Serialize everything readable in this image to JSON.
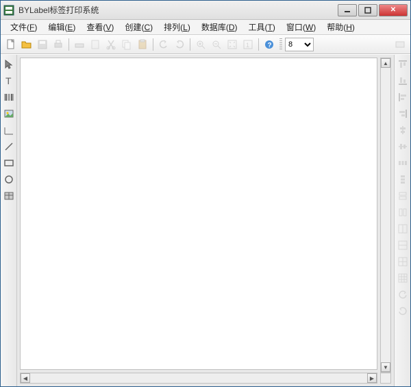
{
  "window": {
    "title": "BYLabel标签打印系统"
  },
  "menu": {
    "file": {
      "label": "文件",
      "key": "F"
    },
    "edit": {
      "label": "编辑",
      "key": "E"
    },
    "view": {
      "label": "查看",
      "key": "V"
    },
    "create": {
      "label": "创建",
      "key": "C"
    },
    "arrange": {
      "label": "排列",
      "key": "L"
    },
    "database": {
      "label": "数据库",
      "key": "D"
    },
    "tools": {
      "label": "工具",
      "key": "T"
    },
    "window": {
      "label": "窗口",
      "key": "W"
    },
    "help": {
      "label": "帮助",
      "key": "H"
    }
  },
  "toolbar": {
    "zoom_value": "8"
  },
  "icons": {
    "new": "new-file-icon",
    "open": "open-folder-icon",
    "save": "save-icon",
    "print": "print-icon",
    "cut": "cut-icon",
    "copy": "copy-icon",
    "paste": "paste-icon",
    "undo": "undo-icon",
    "redo": "redo-icon",
    "zoom_in": "zoom-in-icon",
    "zoom_out": "zoom-out-icon",
    "fit": "fit-screen-icon",
    "actual": "actual-size-icon",
    "help": "help-icon"
  },
  "left_tools": [
    "pointer",
    "text",
    "barcode",
    "image",
    "line-horiz",
    "line-diag",
    "rectangle",
    "circle",
    "shape"
  ],
  "right_tools": [
    "align-top",
    "align-bottom",
    "align-left",
    "align-right",
    "center-h",
    "center-v",
    "distribute-h",
    "distribute-v",
    "same-width",
    "same-height",
    "grid-1",
    "grid-2",
    "grid-3",
    "grid-4",
    "rotate-ccw",
    "rotate-cw"
  ],
  "colors": {
    "accent": "#2c5f8d",
    "close": "#c33",
    "toolbar_bg": "#ececec",
    "canvas": "#ffffff"
  }
}
